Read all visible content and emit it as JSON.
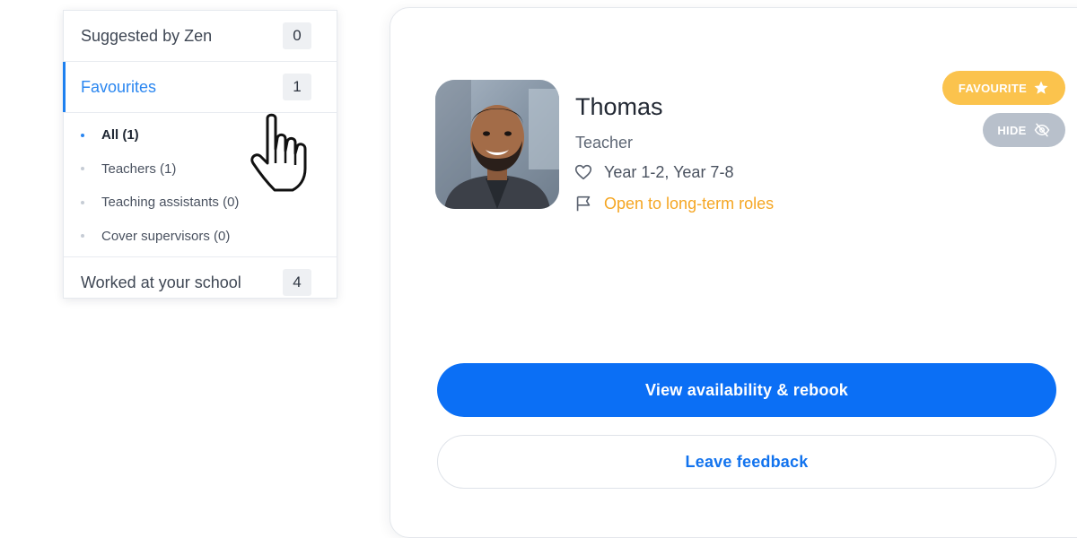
{
  "filters": {
    "items": [
      {
        "label": "Suggested by Zen",
        "count": "0"
      },
      {
        "label": "Favourites",
        "count": "1"
      }
    ],
    "sub_items": [
      {
        "label": "All (1)"
      },
      {
        "label": "Teachers (1)"
      },
      {
        "label": "Teaching assistants (0)"
      },
      {
        "label": "Cover supervisors (0)"
      }
    ],
    "worked": {
      "label": "Worked at your school",
      "count": "4"
    }
  },
  "profile": {
    "name": "Thomas",
    "role": "Teacher",
    "years": "Year 1-2, Year 7-8",
    "availability_note": "Open to long-term roles",
    "favourite_label": "FAVOURITE",
    "hide_label": "HIDE"
  },
  "actions": {
    "primary_label": "View availability & rebook",
    "secondary_label": "Leave feedback"
  },
  "colors": {
    "accent": "#0b6ff5",
    "favourite": "#fbc34d",
    "long_term": "#f5a623",
    "hide": "#b8c0cb"
  },
  "icons": {
    "favourite": "star-icon",
    "hide": "eye-slash-icon",
    "years": "heart-icon",
    "long_term": "flag-icon",
    "cursor": "hand-pointer-icon"
  }
}
